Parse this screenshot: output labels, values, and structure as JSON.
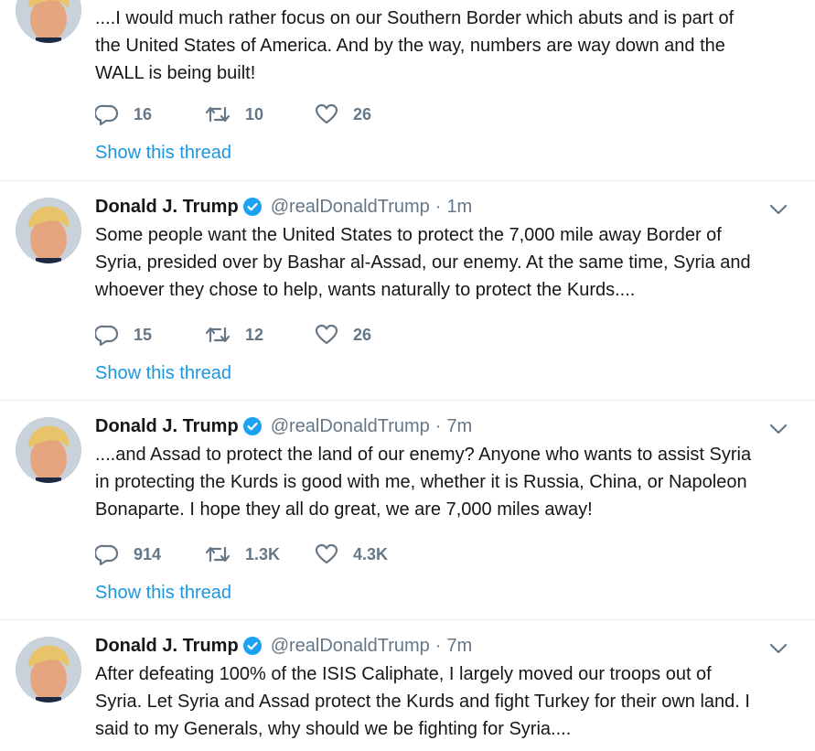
{
  "colors": {
    "link": "#1b95e0",
    "verified": "#1da1f2",
    "muted": "#657786",
    "divider": "#e6ecf0"
  },
  "tweets": [
    {
      "text": "....I would much rather focus on our Southern Border which abuts and is part of\nthe United States of America. And by the way, numbers are way down and the\nWALL is being built!",
      "replies": "16",
      "retweets": "10",
      "likes": "26",
      "show_thread": "Show this thread"
    },
    {
      "name": "Donald J. Trump",
      "handle": "@realDonaldTrump",
      "separator": "·",
      "time": "1m",
      "text": "Some people want the United States to protect the 7,000 mile away Border of\nSyria, presided over by Bashar al-Assad, our enemy. At the same time, Syria and\nwhoever they chose to help, wants naturally to protect the Kurds....",
      "replies": "15",
      "retweets": "12",
      "likes": "26",
      "show_thread": "Show this thread"
    },
    {
      "name": "Donald J. Trump",
      "handle": "@realDonaldTrump",
      "separator": "·",
      "time": "7m",
      "text": "....and Assad to protect the land of our enemy? Anyone who wants to assist Syria\nin protecting the Kurds is good with me, whether it is Russia, China, or Napoleon\nBonaparte. I hope they all do great, we are 7,000 miles away!",
      "replies": "914",
      "retweets": "1.3K",
      "likes": "4.3K",
      "show_thread": "Show this thread"
    },
    {
      "name": "Donald J. Trump",
      "handle": "@realDonaldTrump",
      "separator": "·",
      "time": "7m",
      "text": "After defeating 100% of the ISIS Caliphate, I largely moved our troops out of\nSyria. Let Syria and Assad protect the Kurds and fight Turkey for their own land. I\nsaid to my Generals, why should we be fighting for Syria...."
    }
  ]
}
